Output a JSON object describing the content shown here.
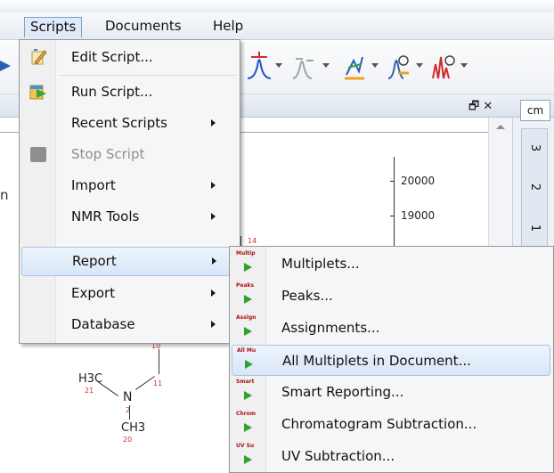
{
  "menubar": {
    "items": [
      {
        "label": "Scripts"
      },
      {
        "label": "Documents"
      },
      {
        "label": "Help"
      }
    ]
  },
  "scripts_menu": {
    "items": [
      {
        "label": "Edit Script...",
        "icon": "edit-script-icon",
        "enabled": true,
        "submenu": false
      },
      {
        "label": "Run Script...",
        "icon": "run-script-icon",
        "enabled": true,
        "submenu": false
      },
      {
        "label": "Recent Scripts",
        "enabled": true,
        "submenu": true
      },
      {
        "label": "Stop Script",
        "icon": "stop-icon",
        "enabled": false,
        "submenu": false
      },
      {
        "label": "Import",
        "enabled": true,
        "submenu": true
      },
      {
        "label": "NMR Tools",
        "enabled": true,
        "submenu": true
      },
      {
        "label": "Report",
        "enabled": true,
        "submenu": true,
        "highlighted": true
      },
      {
        "label": "Export",
        "enabled": true,
        "submenu": true
      },
      {
        "label": "Database",
        "enabled": true,
        "submenu": true
      }
    ]
  },
  "report_submenu": {
    "items": [
      {
        "label": "Multiplets...",
        "icon_tag": "Multip"
      },
      {
        "label": "Peaks...",
        "icon_tag": "Peaks"
      },
      {
        "label": "Assignments...",
        "icon_tag": "Assign"
      },
      {
        "label": "All Multiplets in Document...",
        "icon_tag": "All Mu",
        "highlighted": true
      },
      {
        "label": "Smart Reporting...",
        "icon_tag": "Smart"
      },
      {
        "label": "Chromatogram Subtraction...",
        "icon_tag": "Chrom"
      },
      {
        "label": "UV Subtraction...",
        "icon_tag": "UV Su"
      }
    ]
  },
  "panel": {
    "cm_label": "cm",
    "page_tabs": [
      "3",
      "2",
      "1"
    ],
    "tab_controls": "🗗 ✕"
  },
  "document": {
    "left_cut_text": "n",
    "axis_labels": [
      "20000",
      "19000"
    ],
    "molecule": {
      "h3c": "H3C",
      "n": "N",
      "ch3": "CH3",
      "num_14": "14",
      "num_10": "10",
      "num_11": "11",
      "num_21": "21",
      "num_2": "2",
      "num_20": "20"
    }
  },
  "colors": {
    "menu_highlight": "#d8e6f7",
    "menu_highlight_border": "#a8c4e8",
    "disabled_text": "#8d8d8d",
    "play_green": "#2fa12f",
    "tag_red": "#b01010"
  }
}
